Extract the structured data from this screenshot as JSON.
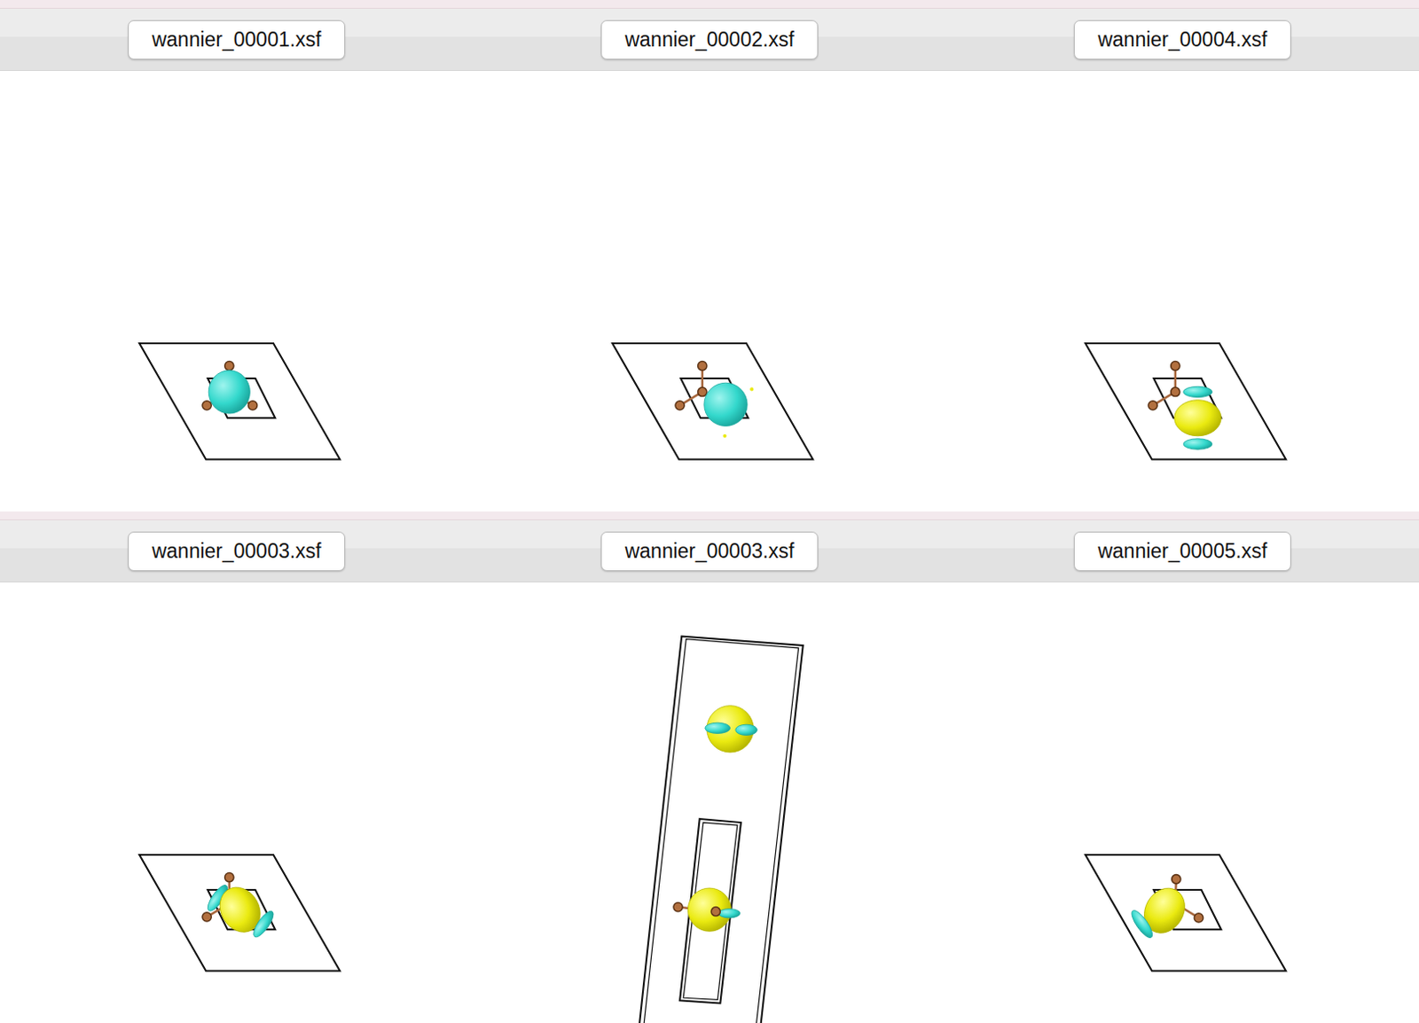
{
  "rows": [
    [
      {
        "label": "wannier_00001.xsf",
        "kind": "s-center"
      },
      {
        "label": "wannier_00002.xsf",
        "kind": "s-offset"
      },
      {
        "label": "wannier_00004.xsf",
        "kind": "p-vertical"
      }
    ],
    [
      {
        "label": "wannier_00003.xsf",
        "kind": "p-diagonal"
      },
      {
        "label": "wannier_00003.xsf",
        "kind": "side-view"
      },
      {
        "label": "wannier_00005.xsf",
        "kind": "p-diagonal-left"
      }
    ]
  ]
}
